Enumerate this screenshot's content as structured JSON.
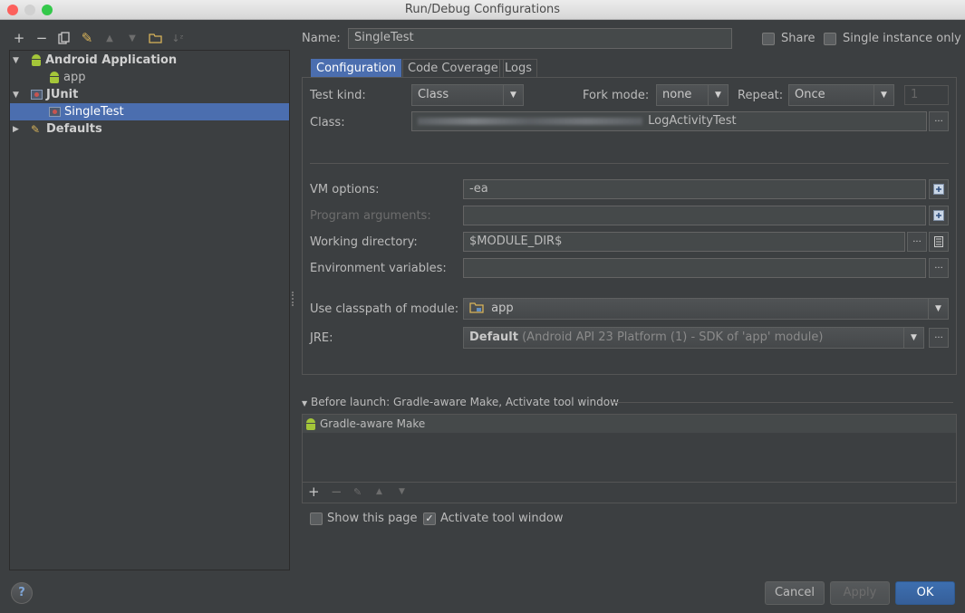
{
  "window": {
    "title": "Run/Debug Configurations"
  },
  "tree": {
    "items": [
      {
        "label": "Android Application"
      },
      {
        "label": "app"
      },
      {
        "label": "JUnit"
      },
      {
        "label": "SingleTest"
      },
      {
        "label": "Defaults"
      }
    ]
  },
  "header": {
    "name_label": "Name:",
    "name_value": "SingleTest",
    "share_label": "Share",
    "single_instance_label": "Single instance only"
  },
  "tabs": [
    {
      "label": "Configuration"
    },
    {
      "label": "Code Coverage"
    },
    {
      "label": "Logs"
    }
  ],
  "config": {
    "test_kind_label": "Test kind:",
    "test_kind_value": "Class",
    "fork_mode_label": "Fork mode:",
    "fork_mode_value": "none",
    "repeat_label": "Repeat:",
    "repeat_value": "Once",
    "repeat_count": "1",
    "class_label": "Class:",
    "class_value": "LogActivityTest",
    "vm_options_label": "VM options:",
    "vm_options_value": "-ea",
    "program_args_label": "Program arguments:",
    "working_dir_label": "Working directory:",
    "working_dir_value": "$MODULE_DIR$",
    "env_vars_label": "Environment variables:",
    "classpath_label": "Use classpath of module:",
    "classpath_value": "app",
    "jre_label": "JRE:",
    "jre_value_bold": "Default",
    "jre_value_rest": " (Android API 23 Platform (1) - SDK of 'app' module)"
  },
  "before_launch": {
    "title": "Before launch: Gradle-aware Make, Activate tool window",
    "items": [
      {
        "label": "Gradle-aware Make"
      }
    ]
  },
  "options": {
    "show_page_label": "Show this page",
    "show_page_checked": false,
    "activate_tool_label": "Activate tool window",
    "activate_tool_checked": true
  },
  "buttons": {
    "cancel": "Cancel",
    "apply": "Apply",
    "ok": "OK",
    "help": "?"
  },
  "colors": {
    "background": "#3c3f41",
    "selection": "#4b6eaf",
    "android_green": "#a4c639"
  }
}
